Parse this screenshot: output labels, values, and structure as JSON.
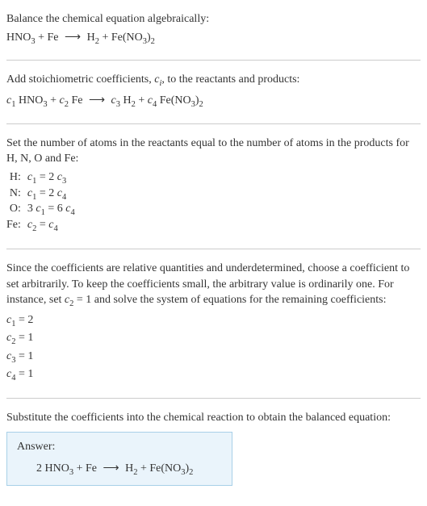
{
  "sec1": {
    "line1": "Balance the chemical equation algebraically:"
  },
  "sec2": {
    "text": "Add stoichiometric coefficients, "
  },
  "sec2_tail": ", to the reactants and products:",
  "sec3": "Set the number of atoms in the reactants equal to the number of atoms in the products for H, N, O and Fe:",
  "atoms": {
    "h_label": "H:",
    "n_label": "N:",
    "o_label": "O:",
    "fe_label": "Fe:"
  },
  "sec4": {
    "p1": "Since the coefficients are relative quantities and underdetermined, choose a coefficient to set arbitrarily. To keep the coefficients small, the arbitrary value is ordinarily one. For instance, set ",
    "p1_tail": " = 1 and solve the system of equations for the remaining coefficients:"
  },
  "coeffs": {
    "c1": " = 2",
    "c2": " = 1",
    "c3": " = 1",
    "c4": " = 1"
  },
  "sec5": "Substitute the coefficients into the chemical reaction to obtain the balanced equation:",
  "answer": {
    "label": "Answer:"
  },
  "chem": {
    "hno3": "HNO",
    "fe": "Fe",
    "h2": "H",
    "feno3": "Fe(NO",
    "arrow": "⟶",
    "plus": " + "
  }
}
